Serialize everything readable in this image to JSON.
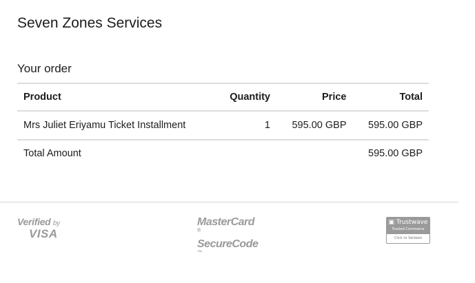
{
  "merchant_name": "Seven Zones Services",
  "order": {
    "heading": "Your order",
    "columns": [
      "Product",
      "Quantity",
      "Price",
      "Total"
    ],
    "items": [
      {
        "product": "Mrs Juliet Eriyamu Ticket Installment",
        "quantity": "1",
        "price": "595.00 GBP",
        "total": "595.00 GBP"
      }
    ],
    "total_label": "Total Amount",
    "total_value": "595.00 GBP"
  },
  "footer": {
    "logos": {
      "verified_by": "Verified",
      "verified_by_small": "by",
      "visa": "VISA",
      "mastercard_1": "MasterCard",
      "mastercard_2": "SecureCode",
      "trustwave_name": "Trustwave",
      "trustwave_sub": "Trusted Commerce",
      "trustwave_validate": "Click to Validate"
    },
    "colors": {
      "logo_gray": "#9a9a9a",
      "divider": "#d4d4d4"
    }
  }
}
